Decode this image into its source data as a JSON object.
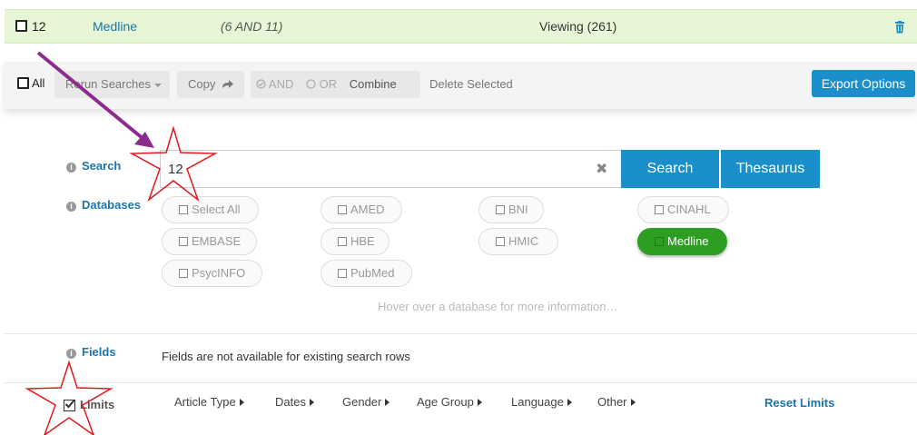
{
  "history_row": {
    "number": "12",
    "database": "Medline",
    "query": "(6 AND 11)",
    "viewing": "Viewing (261)"
  },
  "toolbar": {
    "all_label": "All",
    "rerun_label": "Rerun Searches",
    "copy_label": "Copy",
    "and_label": "AND",
    "or_label": "OR",
    "combine_label": "Combine",
    "delete_label": "Delete Selected",
    "export_label": "Export Options"
  },
  "search": {
    "label": "Search",
    "value": "12",
    "search_button": "Search",
    "thesaurus_button": "Thesaurus"
  },
  "databases": {
    "label": "Databases",
    "items": [
      {
        "name": "Select All",
        "selected": false
      },
      {
        "name": "AMED",
        "selected": false
      },
      {
        "name": "BNI",
        "selected": false
      },
      {
        "name": "CINAHL",
        "selected": false
      },
      {
        "name": "EMBASE",
        "selected": false
      },
      {
        "name": "HBE",
        "selected": false
      },
      {
        "name": "HMIC",
        "selected": false
      },
      {
        "name": "Medline",
        "selected": true
      },
      {
        "name": "PsycINFO",
        "selected": false
      },
      {
        "name": "PubMed",
        "selected": false
      }
    ],
    "hint": "Hover over a database for more information…"
  },
  "fields": {
    "label": "Fields",
    "message": "Fields are not available for existing search rows"
  },
  "limits": {
    "label": "Limits",
    "checked": true,
    "items": [
      "Article Type",
      "Dates",
      "Gender",
      "Age Group",
      "Language",
      "Other"
    ],
    "reset_label": "Reset Limits"
  },
  "colors": {
    "accent": "#1a8fc9",
    "link": "#1a76a8",
    "selected_green": "#2e9e22",
    "history_bg": "#e7f6d6",
    "annotation_arrow": "#8e2c8e",
    "annotation_star": "#e0191b"
  }
}
